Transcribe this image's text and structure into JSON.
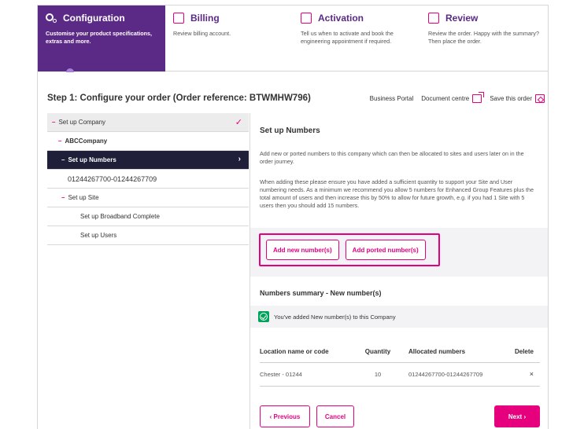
{
  "steps": [
    {
      "title": "Configuration",
      "desc": "Customise your product specifications, extras and more.",
      "icon": "settings-icon"
    },
    {
      "title": "Billing",
      "desc": "Review billing account.",
      "icon": "billing-icon"
    },
    {
      "title": "Activation",
      "desc": "Tell us when to activate and book the engineering appointment if required.",
      "icon": "calendar-icon"
    },
    {
      "title": "Review",
      "desc": "Review the order. Happy with the summary? Then place the order.",
      "icon": "review-icon"
    }
  ],
  "header": {
    "title": "Step 1: Configure your order (Order reference: BTWMHW796)",
    "business_portal": "Business Portal",
    "document_centre": "Document centre",
    "save_order": "Save this order"
  },
  "sidebar": {
    "company_label": "Set up Company",
    "company_name": "ABCCompany",
    "numbers_label": "Set up Numbers",
    "number_range": "01244267700-01244267709",
    "site_label": "Set up Site",
    "broadband_label": "Set up Broadband Complete",
    "users_label": "Set up Users"
  },
  "main": {
    "heading": "Set up Numbers",
    "para1": "Add new or ported numbers to this company which can then be allocated to sites and users later on in the order journey.",
    "para2": "When adding these please ensure you have added a sufficient quantity to support your Site and User numbering needs. As a minimum we recommend you allow 5 numbers for Enhanced Group Features plus the total amount of users and then increase this by 50% to allow for future growth, e.g. if you had 1 Site with 5 users then you should add 15 numbers.",
    "add_new_btn": "Add new number(s)",
    "add_ported_btn": "Add ported number(s)",
    "summary_heading": "Numbers summary - New number(s)",
    "notice": "You've added New number(s) to this Company",
    "table": {
      "headers": [
        "Location name or code",
        "Quantity",
        "Allocated numbers",
        "Delete"
      ],
      "rows": [
        {
          "location": "Chester - 01244",
          "quantity": "10",
          "allocated": "01244267700-01244267709",
          "delete": "×"
        }
      ]
    },
    "previous_btn": "‹  Previous",
    "cancel_btn": "Cancel",
    "next_btn": "Next  ›"
  },
  "colors": {
    "accent": "#e6007e",
    "active_step": "#5b2a86",
    "active_nav": "#1f1f3a",
    "success": "#00a35a"
  }
}
